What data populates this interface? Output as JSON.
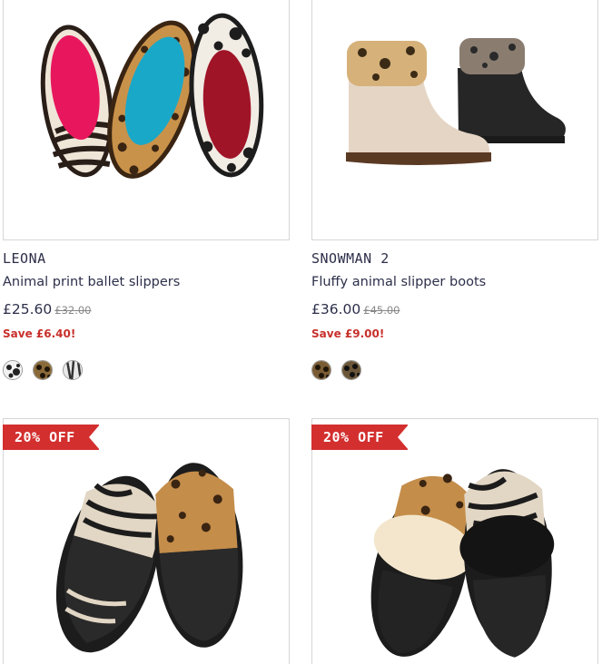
{
  "products": [
    {
      "name": "LEONA",
      "description": "Animal print ballet slippers",
      "price": "£25.60",
      "was_price": "£32.00",
      "saving": "Save £6.40!",
      "swatches": [
        "dalmatian-print",
        "leopard-print",
        "zebra-print"
      ]
    },
    {
      "name": "SNOWMAN 2",
      "description": "Fluffy animal slipper boots",
      "price": "£36.00",
      "was_price": "£45.00",
      "saving": "Save £9.00!",
      "swatches": [
        "leopard-print",
        "leopard-print-dark"
      ]
    },
    {
      "badge": "20% OFF"
    },
    {
      "badge": "20% OFF"
    }
  ],
  "colors": {
    "badge_red": "#d32f2f",
    "save_red": "#c8302b",
    "text_navy": "#2c2f4a"
  }
}
